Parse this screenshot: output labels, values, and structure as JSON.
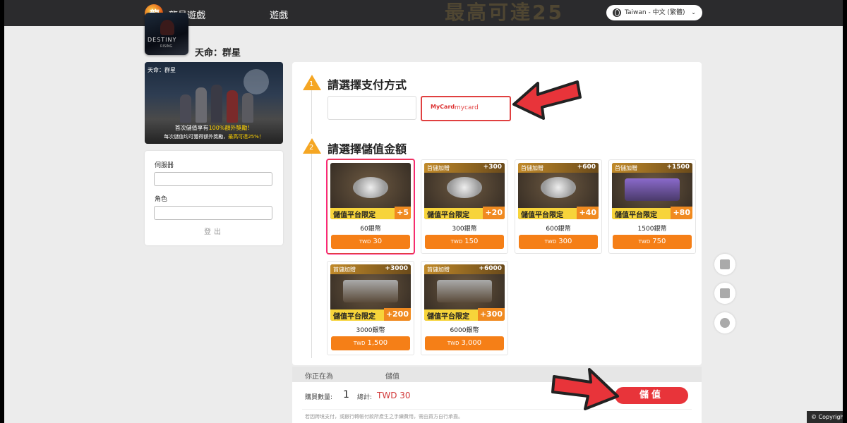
{
  "header": {
    "brand": "龍邑遊戲",
    "nav_games": "遊戲",
    "language": "Taiwan - 中文 (繁體)",
    "bg_text": "最高可達25"
  },
  "game": {
    "icon_title": "DESTINY",
    "icon_subtitle": "RISING",
    "name": "天命：群星"
  },
  "banner": {
    "title": "天命：群星",
    "line1_pre": "首次儲值享有",
    "line1_hl": "100%額外獎勵！",
    "line2_pre": "每次儲值均可獲得額外獎勵，",
    "line2_hl": "最高可達25%！"
  },
  "form": {
    "server_label": "伺服器",
    "role_label": "角色",
    "logout": "登出"
  },
  "step1": {
    "number": "1",
    "title": "請選擇支付方式"
  },
  "payment": {
    "mycard_logo": "MyCard",
    "mycard_label": "mycard"
  },
  "step2": {
    "number": "2",
    "title": "請選擇儲值金額"
  },
  "packages": [
    {
      "badge_left": "",
      "badge_right": "",
      "strip": "儲值平台限定",
      "bonus": "+5",
      "name": "60銀幣",
      "currency": "TWD",
      "price": "30",
      "img": "coins"
    },
    {
      "badge_left": "首儲加贈",
      "badge_right": "+300",
      "strip": "儲值平台限定",
      "bonus": "+20",
      "name": "300銀幣",
      "currency": "TWD",
      "price": "150",
      "img": "coins"
    },
    {
      "badge_left": "首儲加贈",
      "badge_right": "+600",
      "strip": "儲值平台限定",
      "bonus": "+40",
      "name": "600銀幣",
      "currency": "TWD",
      "price": "300",
      "img": "coins"
    },
    {
      "badge_left": "首儲加贈",
      "badge_right": "+1500",
      "strip": "儲值平台限定",
      "bonus": "+80",
      "name": "1500銀幣",
      "currency": "TWD",
      "price": "750",
      "img": "purple"
    },
    {
      "badge_left": "首儲加贈",
      "badge_right": "+3000",
      "strip": "儲值平台限定",
      "bonus": "+200",
      "name": "3000銀幣",
      "currency": "TWD",
      "price": "1,500",
      "img": "chest"
    },
    {
      "badge_left": "首儲加贈",
      "badge_right": "+6000",
      "strip": "儲值平台限定",
      "bonus": "+300",
      "name": "6000銀幣",
      "currency": "TWD",
      "price": "3,000",
      "img": "chest"
    }
  ],
  "summary": {
    "for_label": "你正在為",
    "action_label": "儲值",
    "qty_label": "購買數量:",
    "qty_value": "1",
    "total_label": "總計:",
    "total_value": "TWD 30",
    "note": "若因跨境支付，或銀行轉帳付款所產生之手續費用，需由買方自行承擔。",
    "submit": "儲值"
  },
  "copyright": "© Copyright",
  "colors": {
    "accent": "#f57f17",
    "submit": "#e8343a",
    "selected_border": "#e04040",
    "step_triangle": "#f5a623"
  }
}
